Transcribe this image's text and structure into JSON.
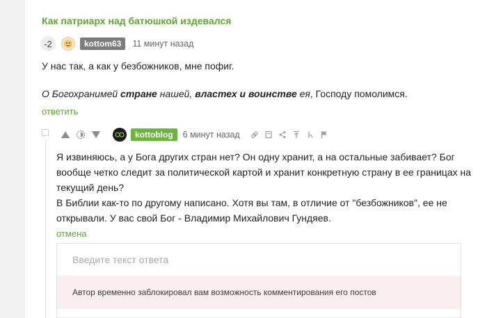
{
  "post": {
    "title": "Как патриарх над батюшкой издевался"
  },
  "comment1": {
    "rating": "-2",
    "username": "kottom63",
    "time": "11 минут назад",
    "line1": "У нас так, а как у безбожников, мне пофиг.",
    "quote": {
      "part1": "О Богохранимей ",
      "part2": "стране",
      "part3": " нашей, ",
      "part4": "властех и воинстве",
      "part5": " ея",
      "part6": ", Господу помолимся."
    },
    "reply_label": "ответить"
  },
  "comment2": {
    "username": "kottoblog",
    "time": "6 минут назад",
    "paragraph1": "Я извиняюсь, а у Бога других стран нет? Он одну хранит, а на остальные забивает? Бог вообще четко следит за политической картой и хранит конкретную страну в ее границах на текущий день?",
    "paragraph2": "В Библии как-то по другому написано. Хотя вы там, в отличие от \"безбожников\", ее не открывали. У вас свой Бог - Владимир Михайлович Гундяев.",
    "cancel_label": "отмена"
  },
  "reply_form": {
    "placeholder": "Введите текст ответа",
    "blocked_notice": "Автор временно заблокировал вам возможность комментирования его постов"
  },
  "icons": {
    "vote_up": "arrow-up-icon",
    "vote_toggle": "moon-icon",
    "vote_down": "arrow-down-icon",
    "link": "link-icon",
    "save": "bookmark-icon",
    "share": "share-icon",
    "go_parent": "arrow-to-top-icon",
    "branch": "branch-icon",
    "report": "flag-icon"
  },
  "colors": {
    "accent_green": "#5ea532",
    "username_chip_grey": "#7c7c7c",
    "username_chip_green": "#6db33f",
    "notice_background": "#fbeeee"
  }
}
